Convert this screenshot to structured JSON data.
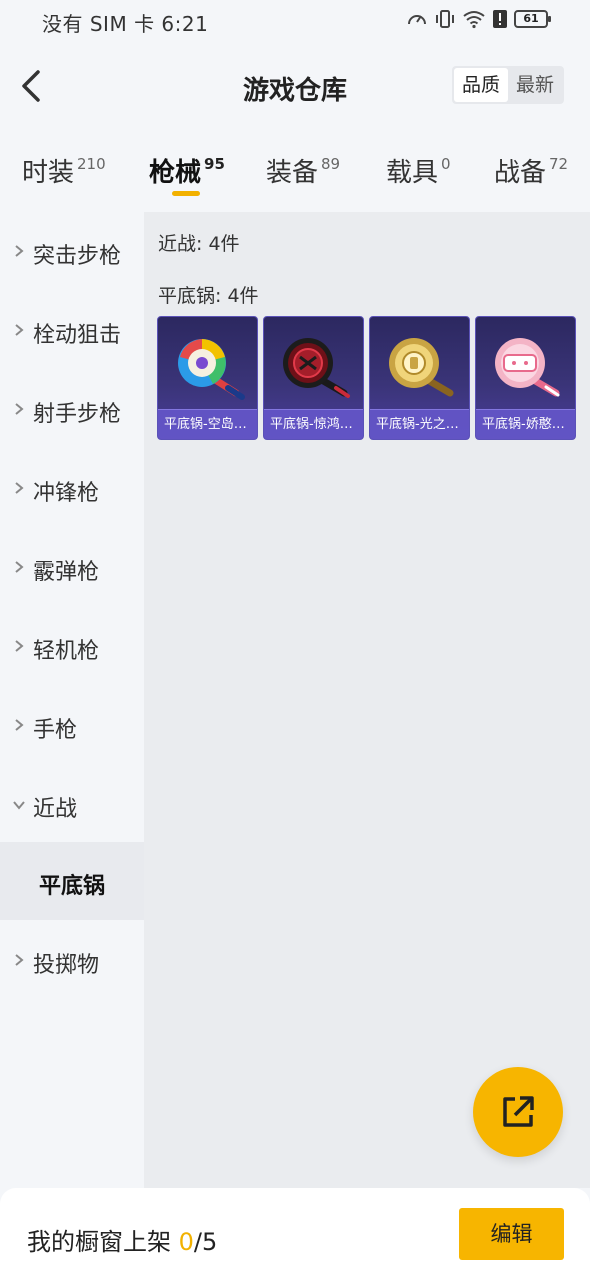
{
  "status_bar": {
    "carrier_time": "没有 SIM 卡 6:21",
    "battery": "61"
  },
  "header": {
    "title": "游戏仓库",
    "sort_options": [
      "品质",
      "最新"
    ],
    "sort_selected": "品质"
  },
  "tabs": [
    {
      "label": "时装",
      "count": "210",
      "active": false
    },
    {
      "label": "枪械",
      "count": "95",
      "active": true
    },
    {
      "label": "装备",
      "count": "89",
      "active": false
    },
    {
      "label": "载具",
      "count": "0",
      "active": false
    },
    {
      "label": "战备",
      "count": "72",
      "active": false
    }
  ],
  "sidebar": {
    "items": [
      {
        "label": "突击步枪",
        "expanded": false
      },
      {
        "label": "栓动狙击",
        "expanded": false
      },
      {
        "label": "射手步枪",
        "expanded": false
      },
      {
        "label": "冲锋枪",
        "expanded": false
      },
      {
        "label": "霰弹枪",
        "expanded": false
      },
      {
        "label": "轻机枪",
        "expanded": false
      },
      {
        "label": "手枪",
        "expanded": false
      },
      {
        "label": "近战",
        "expanded": true
      },
      {
        "label": "平底锅",
        "sub": true,
        "selected": true
      },
      {
        "label": "投掷物",
        "expanded": false
      }
    ]
  },
  "content": {
    "category_summary": "近战: 4件",
    "subcategory_summary": "平底锅: 4件",
    "items": [
      {
        "name": "平底锅-空岛…",
        "icon": "pan-rainbow-icon",
        "colors": [
          "#e44a4a",
          "#f2c200",
          "#2b9be8"
        ]
      },
      {
        "name": "平底锅-惊鸿…",
        "icon": "pan-dark-red-icon",
        "colors": [
          "#1a1a1a",
          "#8a1520",
          "#c92a3a"
        ]
      },
      {
        "name": "平底锅-光之…",
        "icon": "pan-golden-icon",
        "colors": [
          "#c9a443",
          "#f0d57a",
          "#7a5a18"
        ]
      },
      {
        "name": "平底锅-娇憨…",
        "icon": "pan-pink-icon",
        "colors": [
          "#f4b4c6",
          "#ffffff",
          "#e86a8c"
        ]
      }
    ]
  },
  "bottom_bar": {
    "label": "我的橱窗上架",
    "current": "0",
    "total": "/5",
    "edit_label": "编辑"
  },
  "accent_color": "#f7b500"
}
